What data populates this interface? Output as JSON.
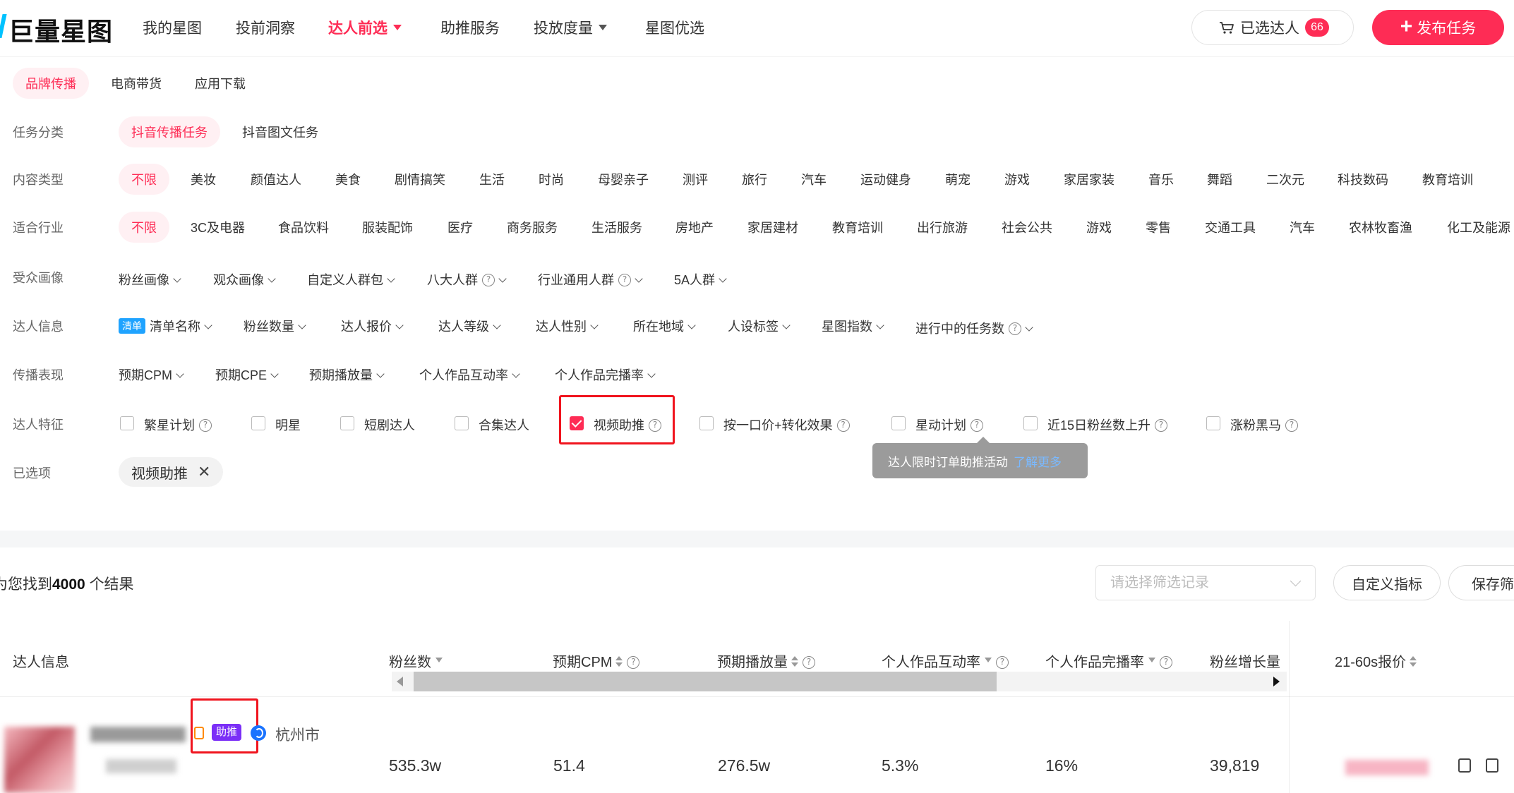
{
  "header": {
    "logo_text": "巨量星图",
    "nav": [
      {
        "label": "我的星图"
      },
      {
        "label": "投前洞察"
      },
      {
        "label": "达人前选"
      },
      {
        "label": "助推服务"
      },
      {
        "label": "投放度量"
      },
      {
        "label": "星图优选"
      }
    ],
    "cart_label": "已选达人",
    "cart_count": "66",
    "publish_label": "发布任务",
    "accent_color": "#fe2c55"
  },
  "top_tabs": [
    "品牌传播",
    "电商带货",
    "应用下载"
  ],
  "filters": {
    "task_category": {
      "label": "任务分类",
      "options": [
        "抖音传播任务",
        "抖音图文任务"
      ]
    },
    "content_type": {
      "label": "内容类型",
      "options": [
        "不限",
        "美妆",
        "颜值达人",
        "美食",
        "剧情搞笑",
        "生活",
        "时尚",
        "母婴亲子",
        "测评",
        "旅行",
        "汽车",
        "运动健身",
        "萌宠",
        "游戏",
        "家居家装",
        "音乐",
        "舞蹈",
        "二次元",
        "科技数码",
        "教育培训"
      ]
    },
    "industry": {
      "label": "适合行业",
      "options": [
        "不限",
        "3C及电器",
        "食品饮料",
        "服装配饰",
        "医疗",
        "商务服务",
        "生活服务",
        "房地产",
        "家居建材",
        "教育培训",
        "出行旅游",
        "社会公共",
        "游戏",
        "零售",
        "交通工具",
        "汽车",
        "农林牧畜渔",
        "化工及能源"
      ]
    },
    "audience": {
      "label": "受众画像",
      "options": [
        "粉丝画像",
        "观众画像",
        "自定义人群包",
        "八大人群",
        "行业通用人群",
        "5A人群"
      ]
    },
    "creator_info": {
      "label": "达人信息",
      "list_badge": "清单",
      "options": [
        "清单名称",
        "粉丝数量",
        "达人报价",
        "达人等级",
        "达人性别",
        "所在地域",
        "人设标签",
        "星图指数",
        "进行中的任务数"
      ]
    },
    "performance": {
      "label": "传播表现",
      "options": [
        "预期CPM",
        "预期CPE",
        "预期播放量",
        "个人作品互动率",
        "个人作品完播率"
      ]
    },
    "features": {
      "label": "达人特征",
      "options": [
        "繁星计划",
        "明星",
        "短剧达人",
        "合集达人",
        "视频助推",
        "按一口价+转化效果",
        "星动计划",
        "近15日粉丝数上升",
        "涨粉黑马"
      ]
    },
    "selected": {
      "label": "已选项",
      "chip": "视频助推",
      "close": "✕"
    }
  },
  "tooltip": {
    "text": "达人限时订单助推活动",
    "link": "了解更多"
  },
  "results": {
    "prefix": "为您找到",
    "count": "4000",
    "suffix": "个结果",
    "history_placeholder": "请选择筛选记录",
    "custom_metric": "自定义指标",
    "save": "保存筛"
  },
  "table": {
    "headers": [
      "达人信息",
      "粉丝数",
      "预期CPM",
      "预期播放量",
      "个人作品互动率",
      "个人作品完播率",
      "粉丝增长量",
      "21-60s报价"
    ],
    "row": {
      "boost_tag": "助推",
      "city": "杭州市",
      "fans": "535.3w",
      "cpm": "51.4",
      "plays": "276.5w",
      "interaction": "5.3%",
      "completion": "16%",
      "growth": "39,819"
    }
  }
}
